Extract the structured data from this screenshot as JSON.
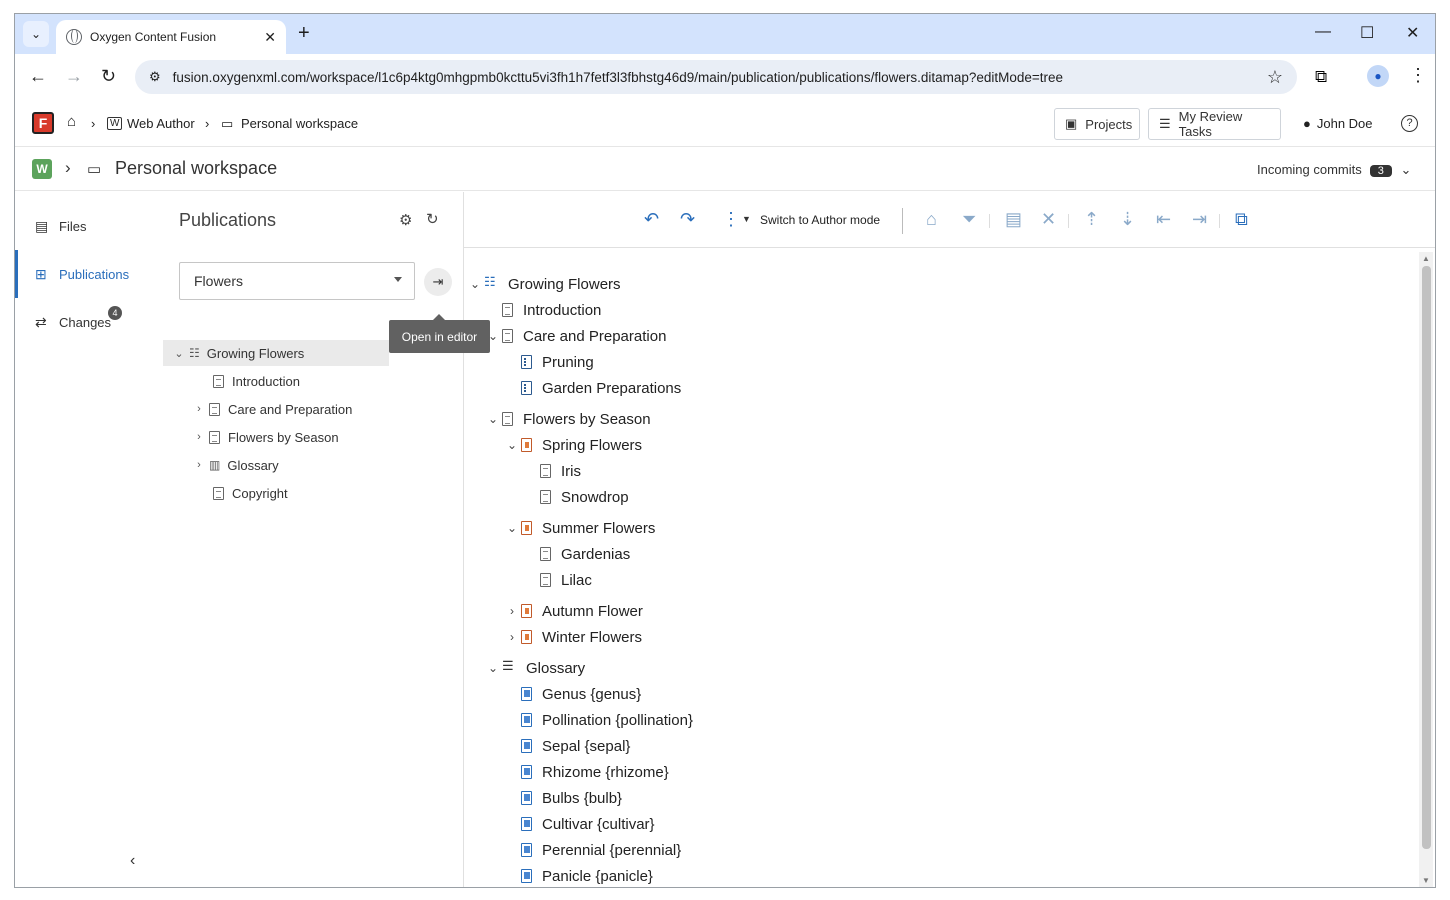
{
  "browser": {
    "tab_title": "Oxygen Content Fusion",
    "url": "fusion.oxygenxml.com/workspace/l1c6p4ktg0mhgpmb0kcttu5vi3fh1h7fetf3l3fbhstg46d9/main/publication/publications/flowers.ditamap?editMode=tree"
  },
  "app_header": {
    "logo": "F",
    "crumb_web_author": "Web Author",
    "crumb_workspace": "Personal workspace",
    "projects_btn": "Projects",
    "review_btn": "My Review Tasks",
    "user_name": "John Doe",
    "help": "?"
  },
  "workspace_header": {
    "logo": "W",
    "title": "Personal workspace",
    "incoming_label": "Incoming commits",
    "incoming_count": "3"
  },
  "left_nav": {
    "files": "Files",
    "publications": "Publications",
    "changes": "Changes",
    "changes_badge": "4"
  },
  "publications_panel": {
    "title": "Publications",
    "selected": "Flowers",
    "tooltip": "Open in editor",
    "tree": [
      "Growing Flowers",
      "Introduction",
      "Care and Preparation",
      "Flowers by Season",
      "Glossary",
      "Copyright"
    ]
  },
  "editor": {
    "switch_label": "Switch to Author mode",
    "tree": [
      {
        "label": "Growing Flowers"
      },
      {
        "label": "Introduction"
      },
      {
        "label": "Care and Preparation"
      },
      {
        "label": "Pruning"
      },
      {
        "label": "Garden Preparations"
      },
      {
        "label": "Flowers by Season"
      },
      {
        "label": "Spring Flowers"
      },
      {
        "label": "Iris"
      },
      {
        "label": "Snowdrop"
      },
      {
        "label": "Summer Flowers"
      },
      {
        "label": "Gardenias"
      },
      {
        "label": "Lilac"
      },
      {
        "label": "Autumn Flower"
      },
      {
        "label": "Winter Flowers"
      },
      {
        "label": "Glossary"
      },
      {
        "label": "Genus {genus}"
      },
      {
        "label": "Pollination {pollination}"
      },
      {
        "label": "Sepal {sepal}"
      },
      {
        "label": "Rhizome {rhizome}"
      },
      {
        "label": "Bulbs {bulb}"
      },
      {
        "label": "Cultivar {cultivar}"
      },
      {
        "label": "Perennial {perennial}"
      },
      {
        "label": "Panicle {panicle}"
      }
    ]
  }
}
